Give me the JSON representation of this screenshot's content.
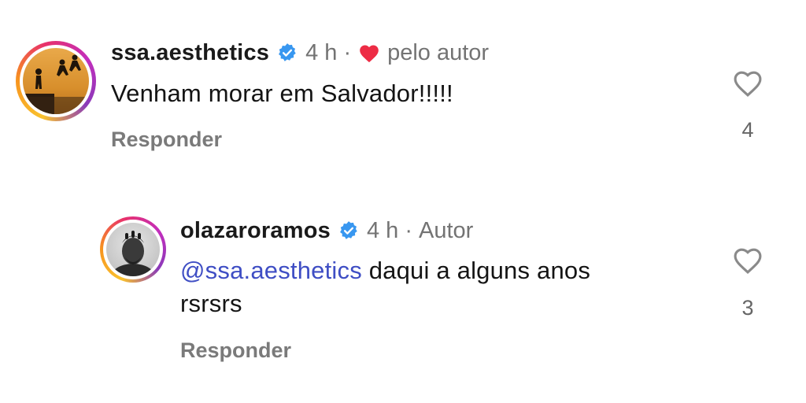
{
  "comments": [
    {
      "username": "ssa.aesthetics",
      "time": "4 h",
      "separator": "·",
      "liked_by_author_label": "pelo autor",
      "text": "Venham morar em Salvador!!!!!",
      "reply_label": "Responder",
      "like_count": "4"
    },
    {
      "username": "olazaroramos",
      "time": "4 h",
      "separator": "·",
      "author_badge": "Autor",
      "mention": "@ssa.aesthetics",
      "text_line1": "daqui a alguns anos",
      "text_line2": "rsrsrs",
      "reply_label": "Responder",
      "like_count": "3"
    }
  ],
  "colors": {
    "verified_blue": "#3897f0",
    "heart_red": "#ed2c45",
    "mention_blue": "#3f4ec4",
    "muted_text": "#737373"
  }
}
